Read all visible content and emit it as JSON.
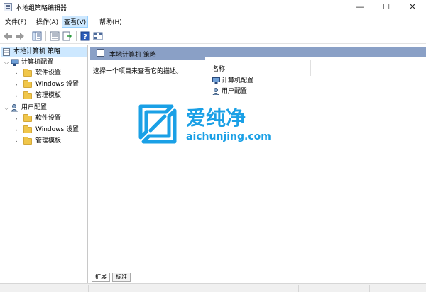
{
  "window": {
    "title": "本地组策略编辑器",
    "minimize": "—",
    "maximize": "☐",
    "close": "✕"
  },
  "menu": [
    {
      "label": "文件(F)"
    },
    {
      "label": "操作(A)"
    },
    {
      "label": "查看(V)",
      "active": true
    },
    {
      "label": "帮助(H)"
    }
  ],
  "toolbar": {
    "icons": [
      "back-icon",
      "forward-icon",
      "show-hide-tree-icon",
      "properties-icon",
      "export-list-icon",
      "help-icon",
      "extend-view-icon"
    ]
  },
  "tree": {
    "root": "本地计算机 策略",
    "computer": {
      "label": "计算机配置",
      "children": [
        "软件设置",
        "Windows 设置",
        "管理模板"
      ]
    },
    "user": {
      "label": "用户配置",
      "children": [
        "软件设置",
        "Windows 设置",
        "管理模板"
      ]
    }
  },
  "main": {
    "header": "本地计算机 策略",
    "description": "选择一个项目来查看它的描述。",
    "column_name": "名称",
    "items": [
      "计算机配置",
      "用户配置"
    ]
  },
  "tabs": {
    "extended": "扩展",
    "standard": "标准"
  },
  "watermark": {
    "brand": "爱纯净",
    "url": "aichunjing.com"
  },
  "colors": {
    "header_band": "#8aa0c6",
    "selection": "#cde8ff",
    "watermark": "#1aa0e6"
  }
}
